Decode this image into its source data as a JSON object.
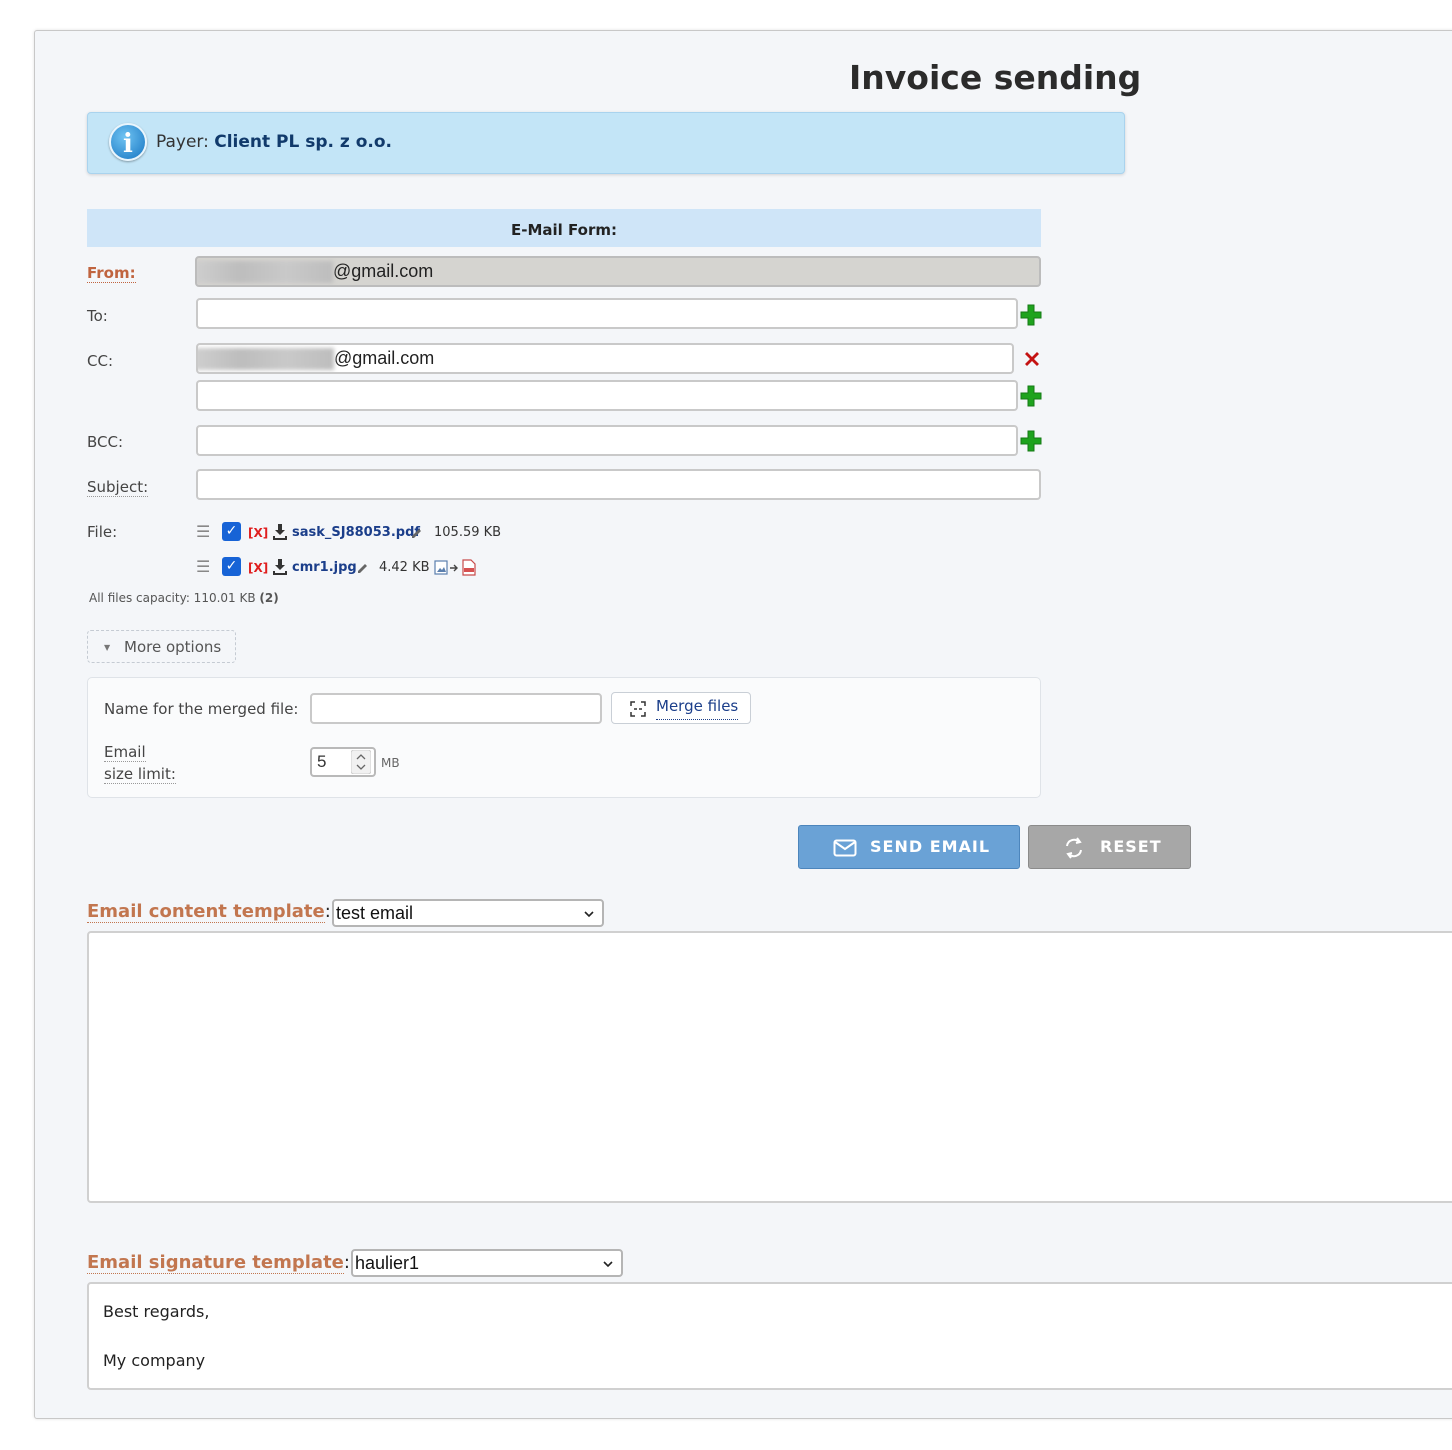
{
  "page": {
    "title": "Invoice sending"
  },
  "info": {
    "payer_label": "Payer:",
    "payer_name": "Client PL sp. z o.o."
  },
  "form": {
    "heading": "E-Mail Form:",
    "from_label": "From:",
    "from_value": "@gmail.com",
    "to_label": "To:",
    "to_value": "",
    "cc_label": "CC:",
    "cc_value": "@gmail.com",
    "cc_value_2": "",
    "bcc_label": "BCC:",
    "bcc_value": "",
    "subject_label": "Subject:",
    "subject_value": "",
    "file_label": "File:",
    "files": [
      {
        "remove": "[X]",
        "name": "sask_SJ88053.pdf",
        "size": "105.59 KB"
      },
      {
        "remove": "[X]",
        "name": "cmr1.jpg",
        "size": "4.42 KB"
      }
    ],
    "capacity_label": "All files capacity: 110.01 KB",
    "capacity_count": "(2)"
  },
  "options": {
    "toggle_label": "More options",
    "merged_name_label": "Name for the merged file:",
    "merged_name_value": "",
    "merge_button": "Merge files",
    "size_limit_label_1": "Email",
    "size_limit_label_2": "size limit:",
    "size_limit_value": "5",
    "size_limit_unit": "MB"
  },
  "actions": {
    "send": "SEND EMAIL",
    "reset": "RESET"
  },
  "content_template": {
    "label": "Email content template",
    "selected": "test email",
    "body": ""
  },
  "signature_template": {
    "label": "Email signature template",
    "selected": "haulier1",
    "line1": "Best regards,",
    "line2": "My company"
  },
  "colors": {
    "accent": "#6aa2d6",
    "label_orange": "#c2764f",
    "info_bg": "#c3e5f7",
    "plus_green": "#22aa22",
    "remove_red": "#cc1111"
  },
  "icons": [
    "info-icon",
    "plus-icon",
    "remove-icon",
    "drag-handle-icon",
    "download-icon",
    "pencil-icon",
    "image-to-pdf-icon",
    "merge-icon",
    "envelope-icon",
    "refresh-icon",
    "chevron-down-icon"
  ]
}
